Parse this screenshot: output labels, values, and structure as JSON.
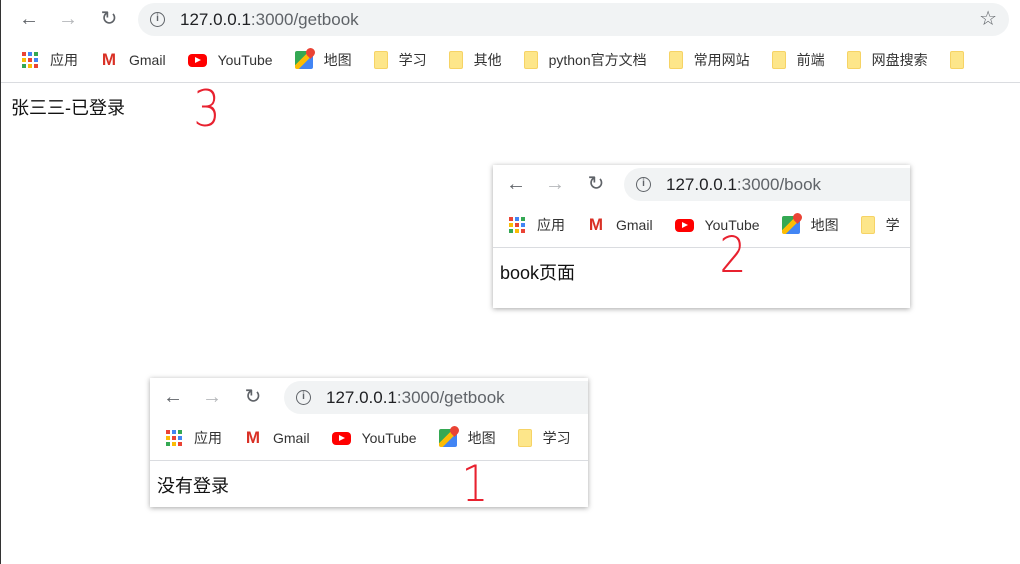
{
  "main": {
    "url_host": "127.0.0.1",
    "url_path": ":3000/getbook",
    "content": "张三三-已登录",
    "annotation": "3",
    "bookmarks": [
      {
        "icon": "apps-icon",
        "label": "应用"
      },
      {
        "icon": "gmail-icon",
        "label": "Gmail"
      },
      {
        "icon": "youtube-icon",
        "label": "YouTube"
      },
      {
        "icon": "maps-icon",
        "label": "地图"
      },
      {
        "icon": "folder-icon",
        "label": "学习"
      },
      {
        "icon": "folder-icon",
        "label": "其他"
      },
      {
        "icon": "folder-icon",
        "label": "python官方文档"
      },
      {
        "icon": "folder-icon",
        "label": "常用网站"
      },
      {
        "icon": "folder-icon",
        "label": "前端"
      },
      {
        "icon": "folder-icon",
        "label": "网盘搜索"
      },
      {
        "icon": "folder-icon",
        "label": ""
      }
    ]
  },
  "inset_book": {
    "url_host": "127.0.0.1",
    "url_path": ":3000/book",
    "content": "book页面",
    "annotation": "2",
    "bookmarks": [
      {
        "icon": "apps-icon",
        "label": "应用"
      },
      {
        "icon": "gmail-icon",
        "label": "Gmail"
      },
      {
        "icon": "youtube-icon",
        "label": "YouTube"
      },
      {
        "icon": "maps-icon",
        "label": "地图"
      },
      {
        "icon": "folder-icon",
        "label": "学"
      }
    ]
  },
  "inset_getbook": {
    "url_host": "127.0.0.1",
    "url_path": ":3000/getbook",
    "content": "没有登录",
    "annotation": "1",
    "bookmarks": [
      {
        "icon": "apps-icon",
        "label": "应用"
      },
      {
        "icon": "gmail-icon",
        "label": "Gmail"
      },
      {
        "icon": "youtube-icon",
        "label": "YouTube"
      },
      {
        "icon": "maps-icon",
        "label": "地图"
      },
      {
        "icon": "folder-icon",
        "label": "学习"
      }
    ]
  },
  "colors": {
    "annotation": "#e8212f",
    "address_bar": "#f1f3f4"
  }
}
